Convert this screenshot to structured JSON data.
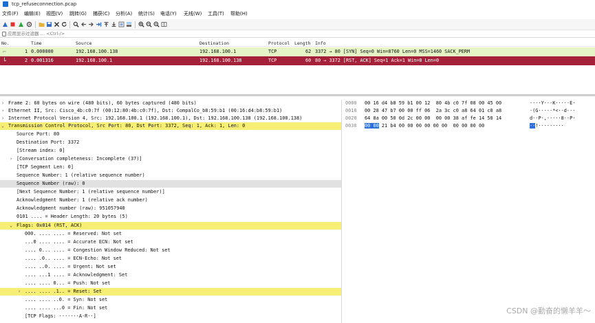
{
  "window": {
    "title": "tcp_refuseconnection.pcap"
  },
  "menu": [
    "文件(F)",
    "编辑(E)",
    "视图(V)",
    "跳转(G)",
    "捕获(C)",
    "分析(A)",
    "统计(S)",
    "电话(Y)",
    "无线(W)",
    "工具(T)",
    "帮助(H)"
  ],
  "filter": {
    "placeholder": "应用显示过滤器 … <Ctrl-/>"
  },
  "packet_list": {
    "headers": [
      "No.",
      "Time",
      "Source",
      "Destination",
      "Protocol",
      "Length",
      "Info"
    ],
    "rows": [
      {
        "no": "1",
        "time": "0.000000",
        "source": "192.168.100.138",
        "destination": "192.168.100.1",
        "protocol": "TCP",
        "length": "62",
        "info": "3372 → 80 [SYN] Seq=0 Win=8760 Len=0 MSS=1460 SACK_PERM"
      },
      {
        "no": "2",
        "time": "0.001316",
        "source": "192.168.100.1",
        "destination": "192.168.100.138",
        "protocol": "TCP",
        "length": "60",
        "info": "80 → 3372 [RST, ACK] Seq=1 Ack=1 Win=0 Len=0"
      }
    ]
  },
  "details": {
    "frame": "Frame 2: 60 bytes on wire (480 bits), 60 bytes captured (480 bits)",
    "ethernet": "Ethernet II, Src: Cisco_4b:c0:7f (00:12:80:4b:c0:7f), Dst: CompalCo_b8:59:b1 (00:16:d4:b8:59:b1)",
    "ip": "Internet Protocol Version 4, Src: 192.168.100.1 (192.168.100.1), Dst: 192.168.100.138 (192.168.100.138)",
    "tcp": "Transmission Control Protocol, Src Port: 80, Dst Port: 3372, Seq: 1, Ack: 1, Len: 0",
    "tcp_fields": [
      "Source Port: 80",
      "Destination Port: 3372",
      "[Stream index: 0]",
      "[Conversation completeness: Incomplete (37)]",
      "[TCP Segment Len: 0]",
      "Sequence Number: 1    (relative sequence number)",
      "Sequence Number (raw): 0",
      "[Next Sequence Number: 1    (relative sequence number)]",
      "Acknowledgment Number: 1    (relative ack number)",
      "Acknowledgment number (raw): 951057940",
      "0101 .... = Header Length: 20 bytes (5)"
    ],
    "flags": "Flags: 0x014 (RST, ACK)",
    "flag_fields": [
      "000. .... .... = Reserved: Not set",
      "...0 .... .... = Accurate ECN: Not set",
      ".... 0... .... = Congestion Window Reduced: Not set",
      ".... .0.. .... = ECN-Echo: Not set",
      ".... ..0. .... = Urgent: Not set",
      ".... ...1 .... = Acknowledgment: Set",
      ".... .... 0... = Push: Not set",
      ".... .... .1.. = Reset: Set",
      ".... .... ..0. = Syn: Not set",
      ".... .... ...0 = Fin: Not set",
      "[TCP Flags: ·······A·R··]"
    ]
  },
  "bytes": {
    "offsets": [
      "0000",
      "0010",
      "0020",
      "0030"
    ],
    "hex": [
      "00 16 d4 b8 59 b1 00 12  80 4b c0 7f 08 00 45 00",
      "00 28 47 b7 00 00 ff 06  2a 3c c0 a8 64 01 c0 a8",
      "64 8a 00 50 0d 2c 00 00  00 00 38 af fe 14 50 14",
      "21 b4 00 00 00 00 00 00  00 00 00 00"
    ],
    "hex_selected": "00 00",
    "ascii": [
      "····Y···K·····E·",
      "·(G·····*<··d···",
      "d··P·,·····8··P·",
      "!·········"
    ],
    "ascii_selected": "··"
  },
  "watermark": "CSDN @勤奋的懒羊羊～"
}
